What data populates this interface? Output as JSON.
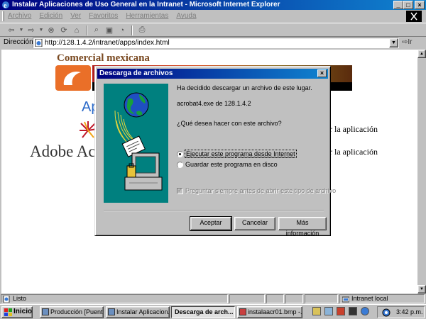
{
  "window": {
    "title": "Instalar Aplicaciones de Uso General en la Intranet - Microsoft Internet Explorer",
    "controls": [
      "_",
      "□",
      "×"
    ]
  },
  "menu": [
    "Archivo",
    "Edición",
    "Ver",
    "Favoritos",
    "Herramientas",
    "Ayuda"
  ],
  "toolbar": {
    "icons": [
      "back-icon",
      "forward-icon",
      "stop-icon",
      "refresh-icon",
      "home-icon",
      "search-icon",
      "favorites-icon",
      "history-icon",
      "print-icon"
    ]
  },
  "address": {
    "label": "Dirección",
    "url": "http://128.1.4.2/intranet/apps/index.html",
    "go": "Ir"
  },
  "page": {
    "brand": "Comercial mexicana",
    "heading_fragment": "Ap",
    "adobe_fragment": "Adobe Acr",
    "line1_fragment": "r la aplicación",
    "line2_fragment": "r la aplicación"
  },
  "dialog": {
    "title": "Descarga de archivos",
    "close": "×",
    "message": "Ha decidido descargar un archivo de este lugar.",
    "file": "acrobat4.exe de 128.1.4.2",
    "question": "¿Qué desea hacer con este archivo?",
    "option_run": "Ejecutar este programa desde Internet",
    "option_save": "Guardar este programa en disco",
    "checkbox": "Preguntar siempre antes de abrir este tipo de archivo",
    "buttons": {
      "accept": "Aceptar",
      "cancel": "Cancelar",
      "more": "Más información"
    }
  },
  "status": {
    "text": "Listo",
    "zone": "Intranet local"
  },
  "taskbar": {
    "start": "Inicio",
    "tasks": [
      "Producción [Puent...",
      "Instalar Aplicacion...",
      "Descarga de arch...",
      "instalaacr01.bmp -..."
    ],
    "clock": "3:42 p.m."
  }
}
